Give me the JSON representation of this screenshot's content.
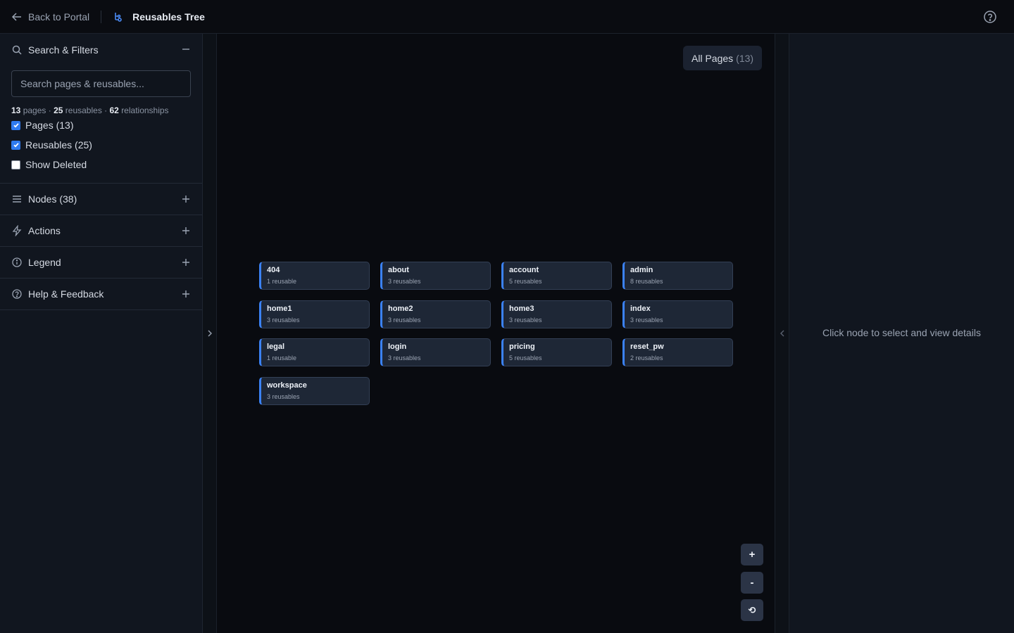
{
  "topbar": {
    "back_label": "Back to Portal",
    "title": "Reusables Tree"
  },
  "sidebar": {
    "search_section": {
      "title": "Search & Filters",
      "search_placeholder": "Search pages & reusables...",
      "stats": {
        "pages_count": "13",
        "pages_label": "pages",
        "reusables_count": "25",
        "reusables_label": "reusables",
        "relationships_count": "62",
        "relationships_label": "relationships"
      },
      "filters": [
        {
          "label": "Pages (13)",
          "checked": true
        },
        {
          "label": "Reusables (25)",
          "checked": true
        },
        {
          "label": "Show Deleted",
          "checked": false
        }
      ]
    },
    "sections": [
      {
        "label": "Nodes (38)",
        "icon": "list-icon"
      },
      {
        "label": "Actions",
        "icon": "bolt-icon"
      },
      {
        "label": "Legend",
        "icon": "info-icon"
      },
      {
        "label": "Help & Feedback",
        "icon": "help-icon"
      }
    ]
  },
  "canvas": {
    "all_pages_label": "All Pages",
    "all_pages_count": "(13)",
    "nodes": [
      {
        "title": "404",
        "subtitle": "1 reusable"
      },
      {
        "title": "about",
        "subtitle": "3 reusables"
      },
      {
        "title": "account",
        "subtitle": "5 reusables"
      },
      {
        "title": "admin",
        "subtitle": "8 reusables"
      },
      {
        "title": "home1",
        "subtitle": "3 reusables"
      },
      {
        "title": "home2",
        "subtitle": "3 reusables"
      },
      {
        "title": "home3",
        "subtitle": "3 reusables"
      },
      {
        "title": "index",
        "subtitle": "3 reusables"
      },
      {
        "title": "legal",
        "subtitle": "1 reusable"
      },
      {
        "title": "login",
        "subtitle": "3 reusables"
      },
      {
        "title": "pricing",
        "subtitle": "5 reusables"
      },
      {
        "title": "reset_pw",
        "subtitle": "2 reusables"
      },
      {
        "title": "workspace",
        "subtitle": "3 reusables"
      }
    ],
    "zoom_in_label": "+",
    "zoom_out_label": "-",
    "reset_label": "⟲"
  },
  "right_panel": {
    "hint": "Click node to select and view details"
  },
  "colors": {
    "accent": "#3b82f6",
    "checkbox": "#2f7bf0",
    "node_bg": "#1e2736"
  }
}
